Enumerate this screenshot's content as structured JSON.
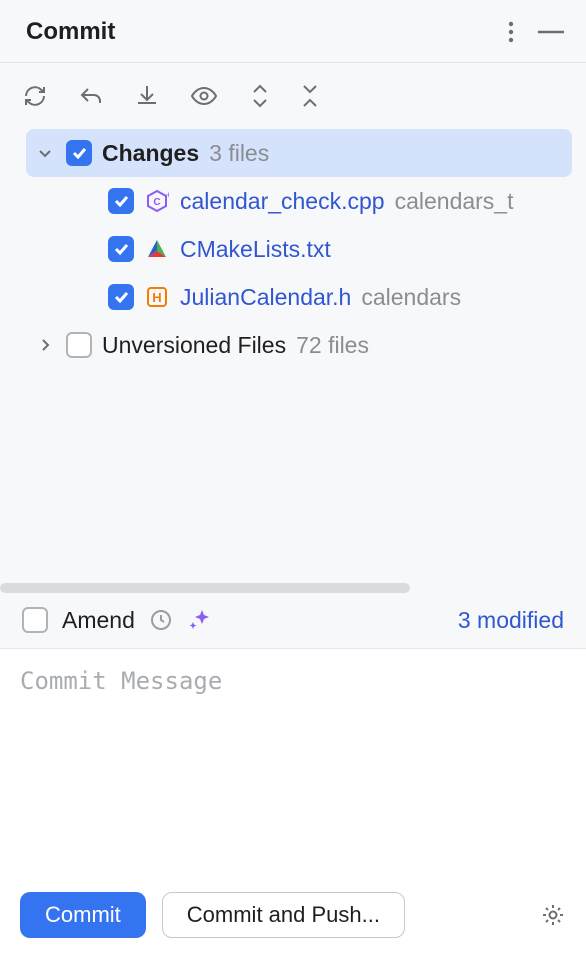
{
  "header": {
    "title": "Commit"
  },
  "tree": {
    "changes": {
      "label": "Changes",
      "count_label": "3 files"
    },
    "files": [
      {
        "name": "calendar_check.cpp",
        "path": "calendars_t"
      },
      {
        "name": "CMakeLists.txt",
        "path": ""
      },
      {
        "name": "JulianCalendar.h",
        "path": "calendars"
      }
    ],
    "unversioned": {
      "label": "Unversioned Files",
      "count_label": "72 files"
    }
  },
  "amend": {
    "label": "Amend"
  },
  "status": {
    "modified": "3 modified"
  },
  "message": {
    "placeholder": "Commit Message"
  },
  "footer": {
    "commit": "Commit",
    "commit_push": "Commit and Push..."
  }
}
